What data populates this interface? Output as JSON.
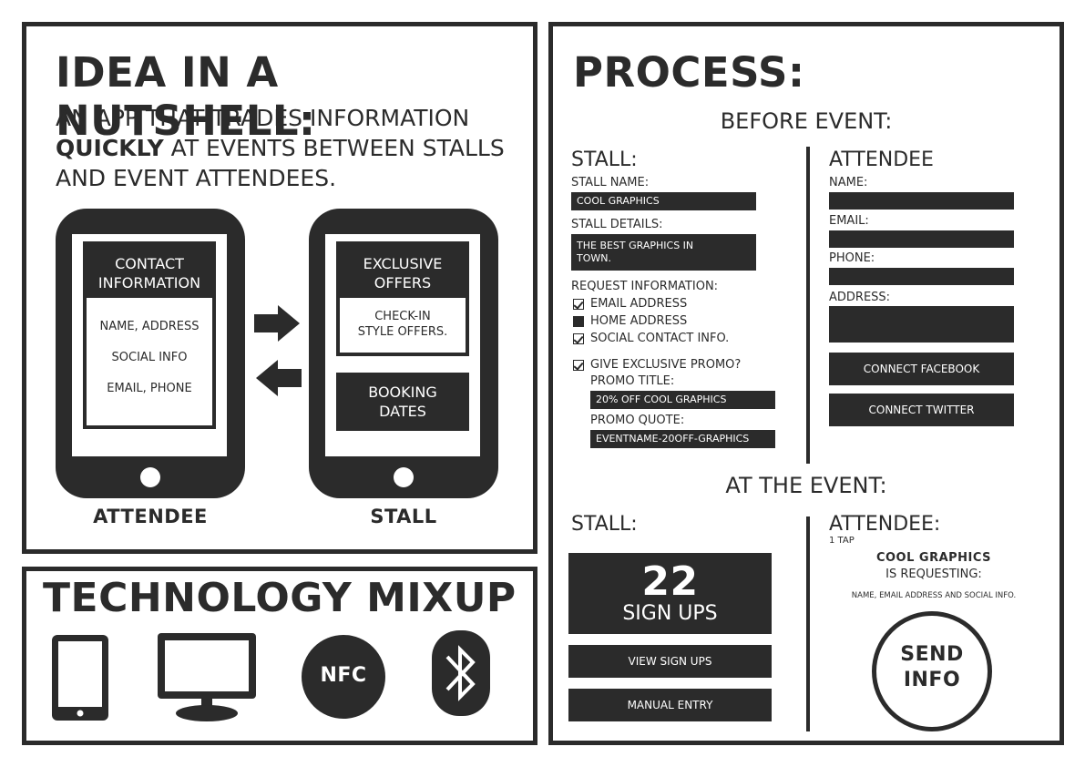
{
  "idea": {
    "title": "IDEA IN A NUTSHELL:",
    "line1": "AN APP THAT TRADES INFORMATION",
    "line2_bold": "QUICKLY",
    "line2_rest": " AT EVENTS BETWEEN STALLS",
    "line3": "AND EVENT ATTENDEES.",
    "attendee_phone": {
      "header": "CONTACT INFORMATION",
      "item1": "NAME, ADDRESS",
      "item2": "SOCIAL INFO",
      "item3": "EMAIL, PHONE",
      "caption": "ATTENDEE"
    },
    "stall_phone": {
      "header": "EXCLUSIVE OFFERS",
      "body": "CHECK-IN STYLE OFFERS.",
      "footer": "BOOKING DATES",
      "caption": "STALL"
    }
  },
  "tech": {
    "title": "TECHNOLOGY MIXUP",
    "nfc_label": "NFC",
    "icons": [
      "tablet-icon",
      "monitor-icon",
      "nfc-icon",
      "bluetooth-icon"
    ]
  },
  "process": {
    "title": "PROCESS:",
    "before_title": "BEFORE EVENT:",
    "stall": {
      "heading": "STALL:",
      "name_label": "STALL NAME:",
      "name_value": "COOL GRAPHICS",
      "details_label": "STALL DETAILS:",
      "details_value": "THE BEST GRAPHICS IN TOWN.",
      "request_label": "REQUEST INFORMATION:",
      "options": [
        {
          "label": "EMAIL ADDRESS",
          "checked": true
        },
        {
          "label": "HOME ADDRESS",
          "checked": false
        },
        {
          "label": "SOCIAL CONTACT INFO.",
          "checked": true
        }
      ],
      "promo_check": "GIVE EXCLUSIVE PROMO?",
      "promo_title_label": "PROMO TITLE:",
      "promo_title_value": "20% OFF COOL GRAPHICS",
      "promo_quote_label": "PROMO QUOTE:",
      "promo_quote_value": "EVENTNAME-20OFF-GRAPHICS"
    },
    "attendee": {
      "heading": "ATTENDEE",
      "name_label": "NAME:",
      "email_label": "EMAIL:",
      "phone_label": "PHONE:",
      "address_label": "ADDRESS:",
      "facebook_button": "CONNECT FACEBOOK",
      "twitter_button": "CONNECT TWITTER"
    },
    "at_event_title": "AT THE EVENT:",
    "event_stall": {
      "heading": "STALL:",
      "count": "22",
      "count_label": "SIGN UPS",
      "view_button": "VIEW SIGN UPS",
      "manual_button": "MANUAL ENTRY"
    },
    "event_attendee": {
      "heading": "ATTENDEE:",
      "tap_note": "1 TAP",
      "requester": "COOL GRAPHICS",
      "requesting": "IS REQUESTING:",
      "fields": "NAME, EMAIL ADDRESS AND SOCIAL INFO.",
      "send_button": "SEND INFO"
    }
  }
}
